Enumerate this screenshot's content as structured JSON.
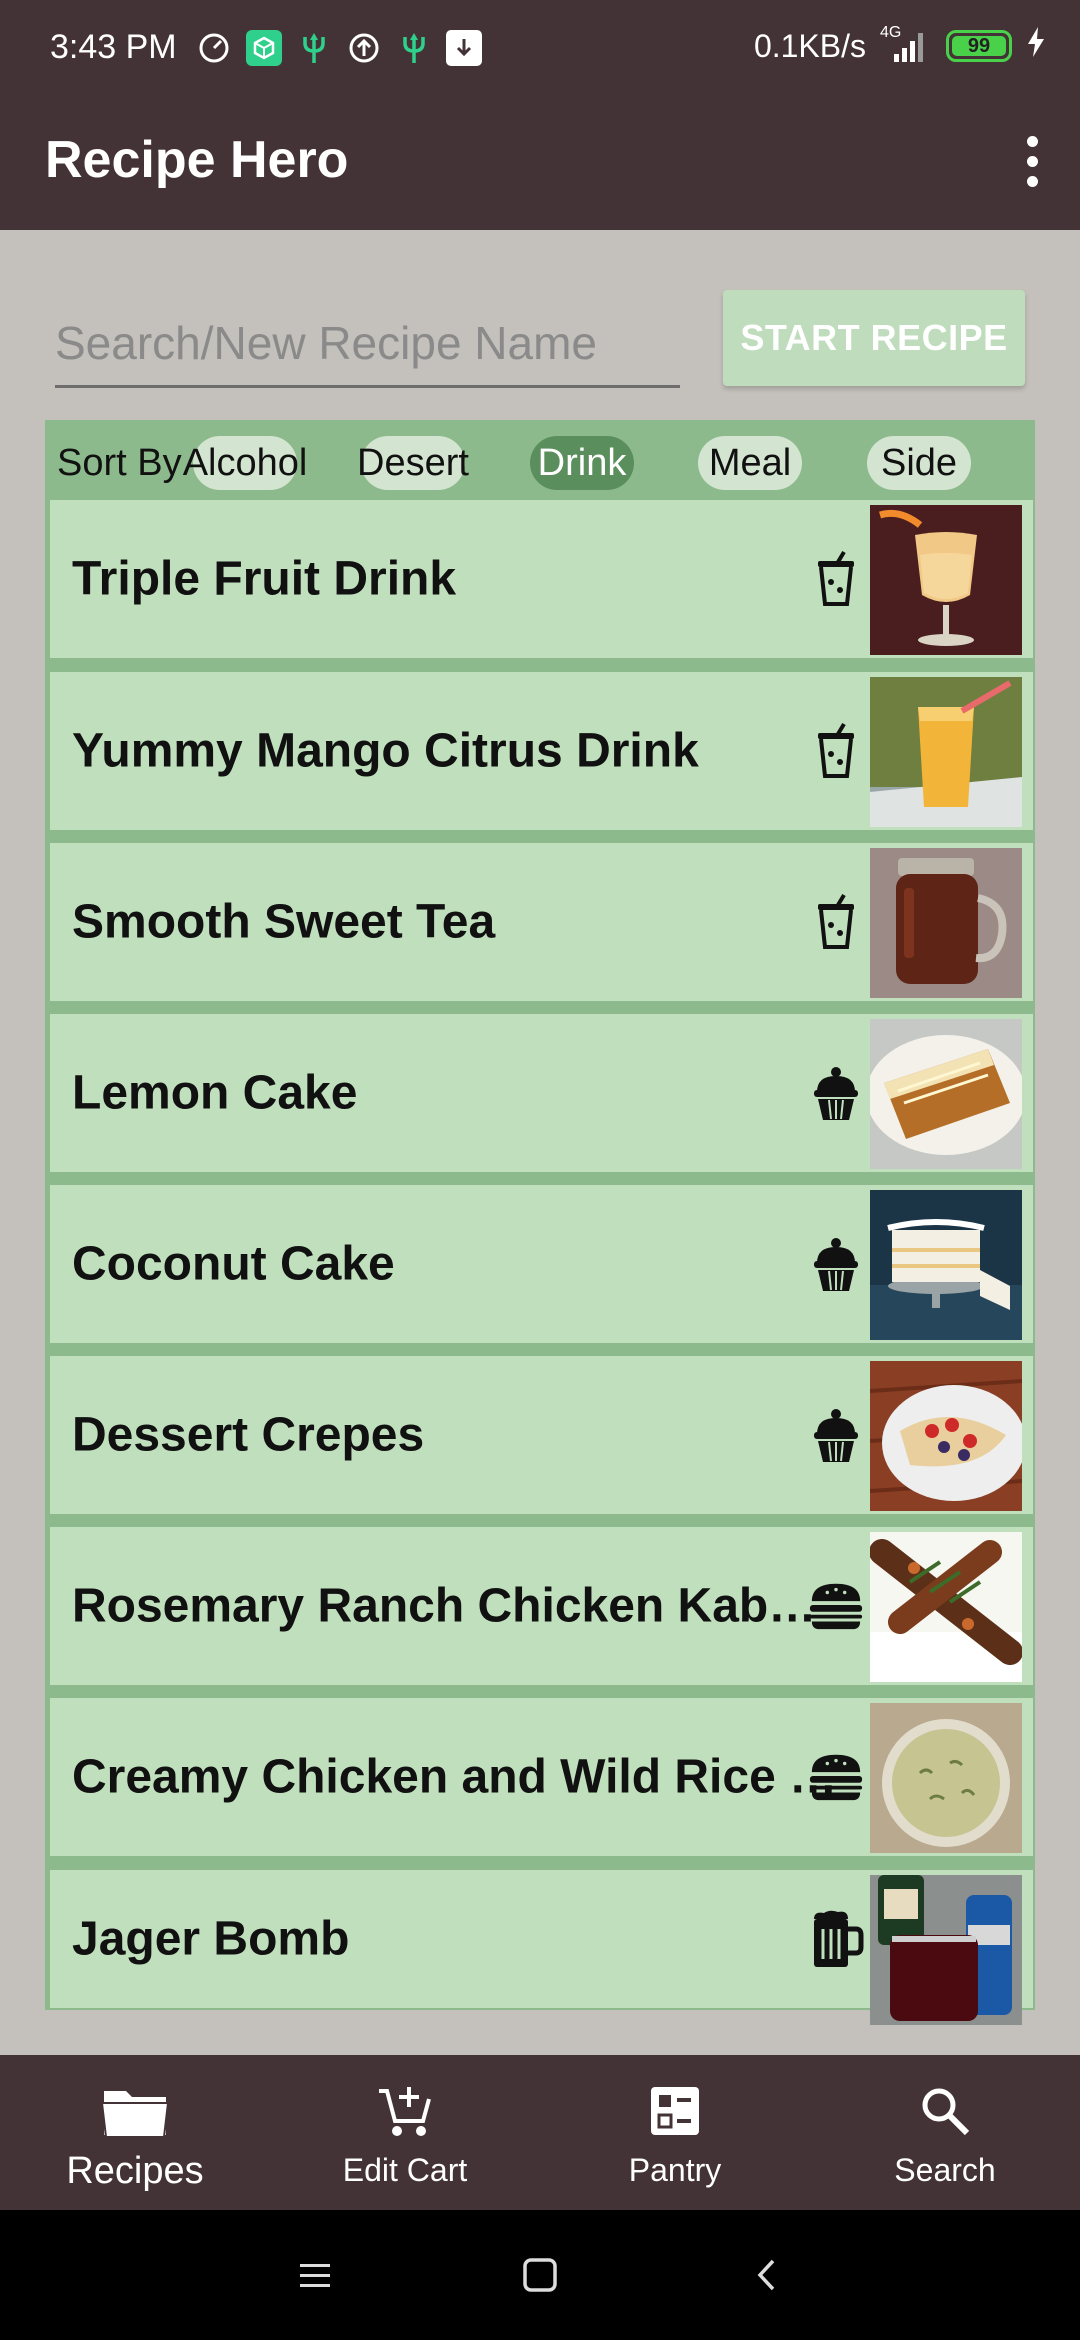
{
  "status_bar": {
    "time": "3:43 PM",
    "network_speed": "0.1KB/s",
    "network_type": "4G",
    "battery": "99",
    "icons": [
      "clock-gauge-icon",
      "package-icon",
      "usb-trident-icon",
      "upload-icon",
      "usb-trident-icon",
      "download-icon",
      "signal-icon",
      "battery-icon",
      "charging-bolt-icon"
    ]
  },
  "app_bar": {
    "title": "Recipe Hero",
    "overflow_icon": "more-vert-icon"
  },
  "search": {
    "placeholder": "Search/New Recipe Name",
    "value": "",
    "start_button_label": "START RECIPE"
  },
  "sort": {
    "label": "Sort By",
    "options": [
      "Alcohol",
      "Desert",
      "Drink",
      "Meal",
      "Side"
    ],
    "selected": "Drink"
  },
  "recipes": [
    {
      "name": "Triple Fruit Drink",
      "category_icon": "cup-icon"
    },
    {
      "name": "Yummy Mango Citrus Drink",
      "category_icon": "cup-icon"
    },
    {
      "name": "Smooth Sweet Tea",
      "category_icon": "cup-icon"
    },
    {
      "name": "Lemon Cake",
      "category_icon": "cupcake-icon"
    },
    {
      "name": "Coconut Cake",
      "category_icon": "cupcake-icon"
    },
    {
      "name": "Dessert Crepes",
      "category_icon": "cupcake-icon"
    },
    {
      "name": "Rosemary Ranch Chicken Kab…",
      "category_icon": "burger-icon"
    },
    {
      "name": "Creamy Chicken and Wild Rice …",
      "category_icon": "burger-icon"
    },
    {
      "name": "Jager Bomb",
      "category_icon": "beer-mug-icon"
    }
  ],
  "bottom_nav": {
    "items": [
      {
        "label": "Recipes",
        "icon": "folder-icon",
        "active": true
      },
      {
        "label": "Edit Cart",
        "icon": "cart-add-icon",
        "active": false
      },
      {
        "label": "Pantry",
        "icon": "list-board-icon",
        "active": false
      },
      {
        "label": "Search",
        "icon": "search-icon",
        "active": false
      }
    ]
  },
  "colors": {
    "app_bar": "#433336",
    "background": "#c4c0bb",
    "card": "#c0dfbd",
    "panel": "#8dba8c",
    "chip_active": "#5a8f5d"
  }
}
